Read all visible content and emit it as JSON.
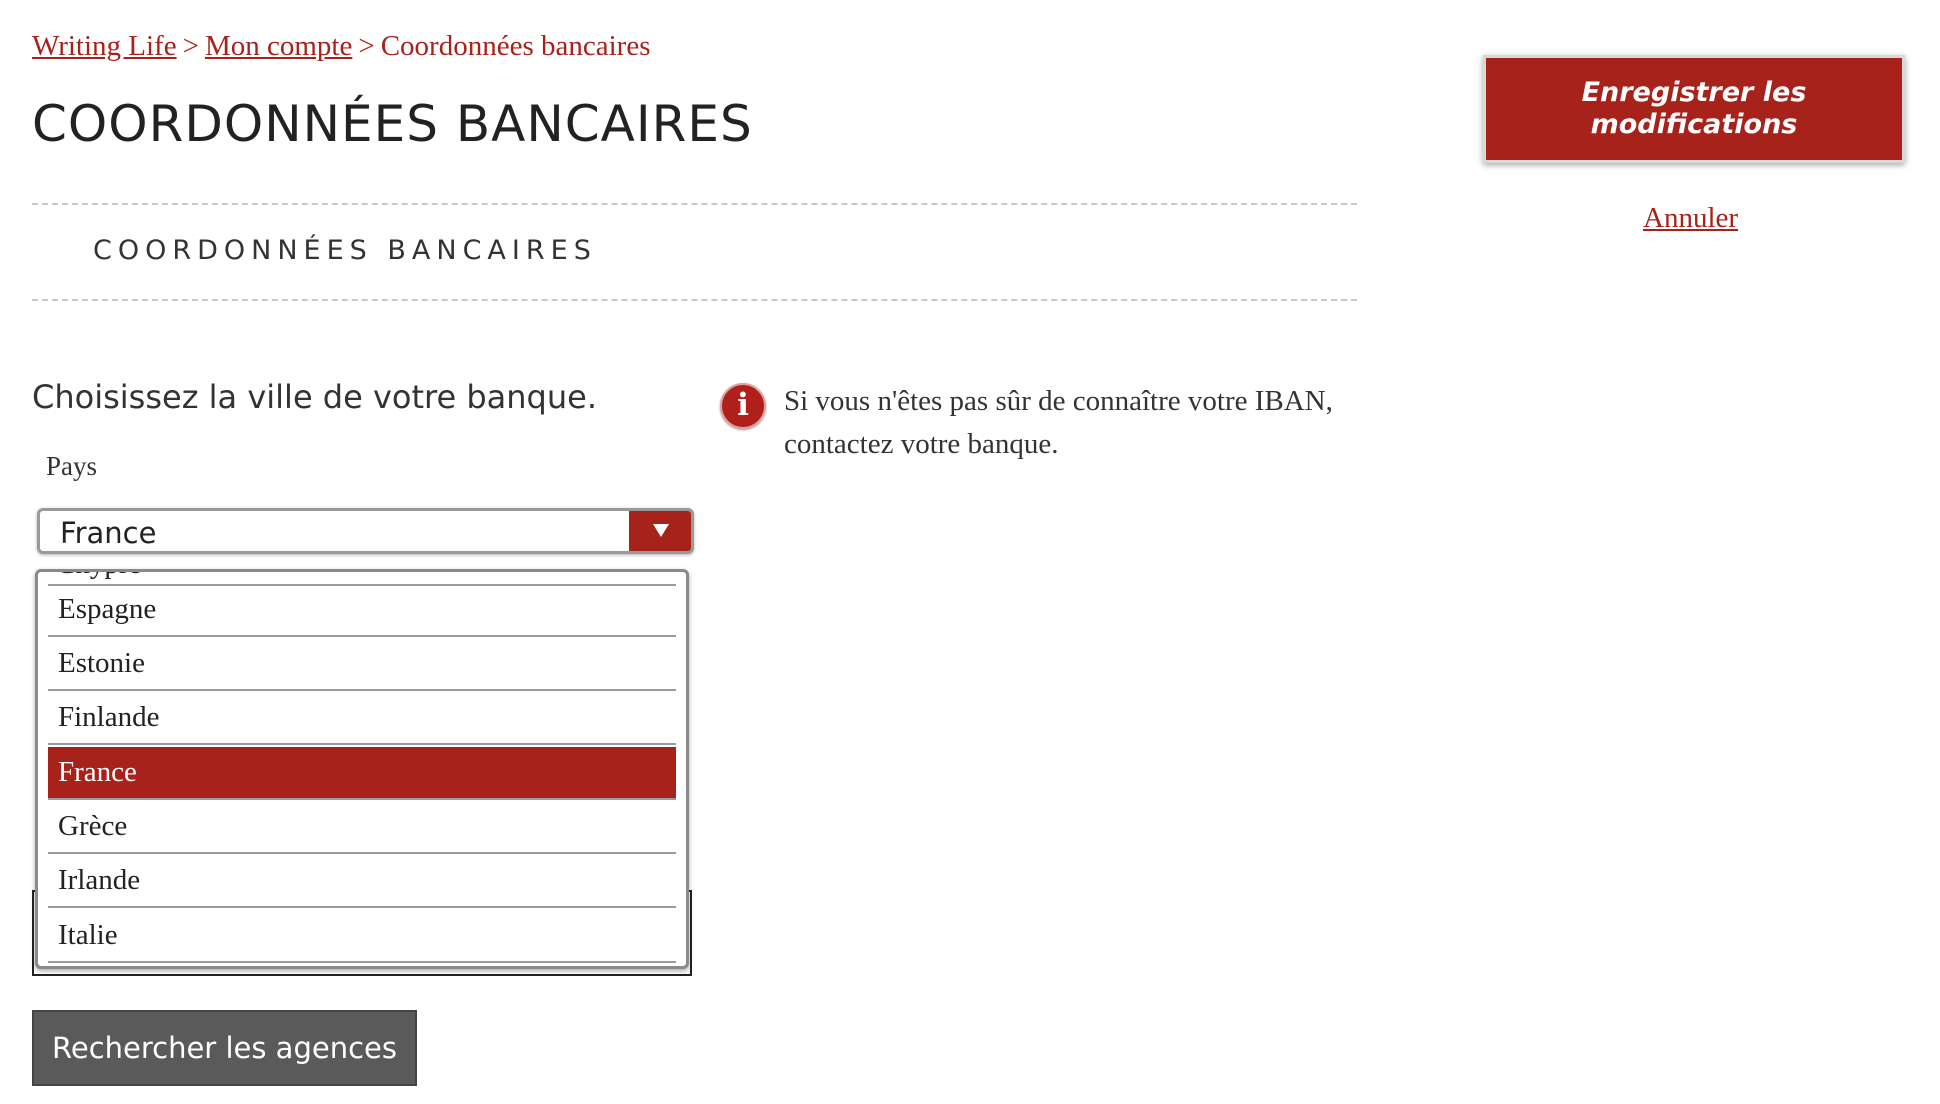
{
  "breadcrumb": {
    "items": [
      "Writing Life",
      "Mon compte",
      "Coordonnées bancaires"
    ],
    "separator": ">"
  },
  "page_title": "COORDONNÉES BANCAIRES",
  "section_title": "COORDONNÉES BANCAIRES",
  "form": {
    "intro": "Choisissez la ville de votre banque.",
    "country_label": "Pays",
    "country_selected": "France",
    "country_options": [
      "Espagne",
      "Estonie",
      "Finlande",
      "France",
      "Grèce",
      "Irlande",
      "Italie"
    ],
    "search_button": "Rechercher les agences"
  },
  "info": {
    "icon": "info-icon",
    "text": "Si vous n'êtes pas sûr de connaître votre IBAN, contactez votre banque."
  },
  "actions": {
    "save_label": "Enregistrer les modifications",
    "cancel_label": "Annuler"
  },
  "colors": {
    "accent": "#a8221c",
    "button_dark": "#5a5a5a"
  }
}
